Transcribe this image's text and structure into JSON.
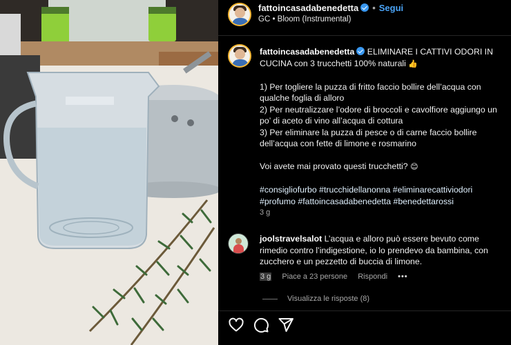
{
  "header": {
    "username": "fattoincasadabenedetta",
    "follow_label": "Segui",
    "audio": "GC • Bloom (Instrumental)"
  },
  "caption": {
    "username": "fattoincasadabenedetta",
    "title": "ELIMINARE I CATTIVI ODORI IN CUCINA con 3 trucchetti 100% naturali",
    "title_emoji": "👍",
    "tip1": "1) Per togliere la puzza di fritto faccio bollire dell’acqua con qualche foglia di alloro",
    "tip2": "2) Per neutralizzare l’odore di broccoli e cavolfiore aggiungo un po’ di aceto di vino all’acqua di cottura",
    "tip3": "3) Per eliminare la puzza di pesce o di carne faccio bollire dell’acqua con fette di limone e rosmarino",
    "question": "Voi avete mai provato questi trucchetti?",
    "question_emoji": "😊",
    "hashtags": "#consigliofurbo #trucchidellanonna #eliminarecattiviodori #profumo #fattoincasadabenedetta #benedettarossi",
    "time": "3 g"
  },
  "comment": {
    "username": "joolstravelsalot",
    "text": "L’acqua e alloro può essere bevuto come rimedio contro l’indigestione, io lo prendevo da bambina, con zucchero e un pezzetto di buccia di limone.",
    "time": "3 g",
    "likes": "Piace a 23 persone",
    "reply": "Rispondi",
    "more": "•••",
    "view_replies": "Visualizza le risposte (8)"
  },
  "icons": {
    "like": "heart-icon",
    "comment": "comment-icon",
    "share": "share-icon",
    "verified": "verified-badge-icon"
  },
  "colors": {
    "background": "#000000",
    "link": "#4aa3f6",
    "verified": "#3897f0",
    "muted": "#a8a8a8"
  }
}
